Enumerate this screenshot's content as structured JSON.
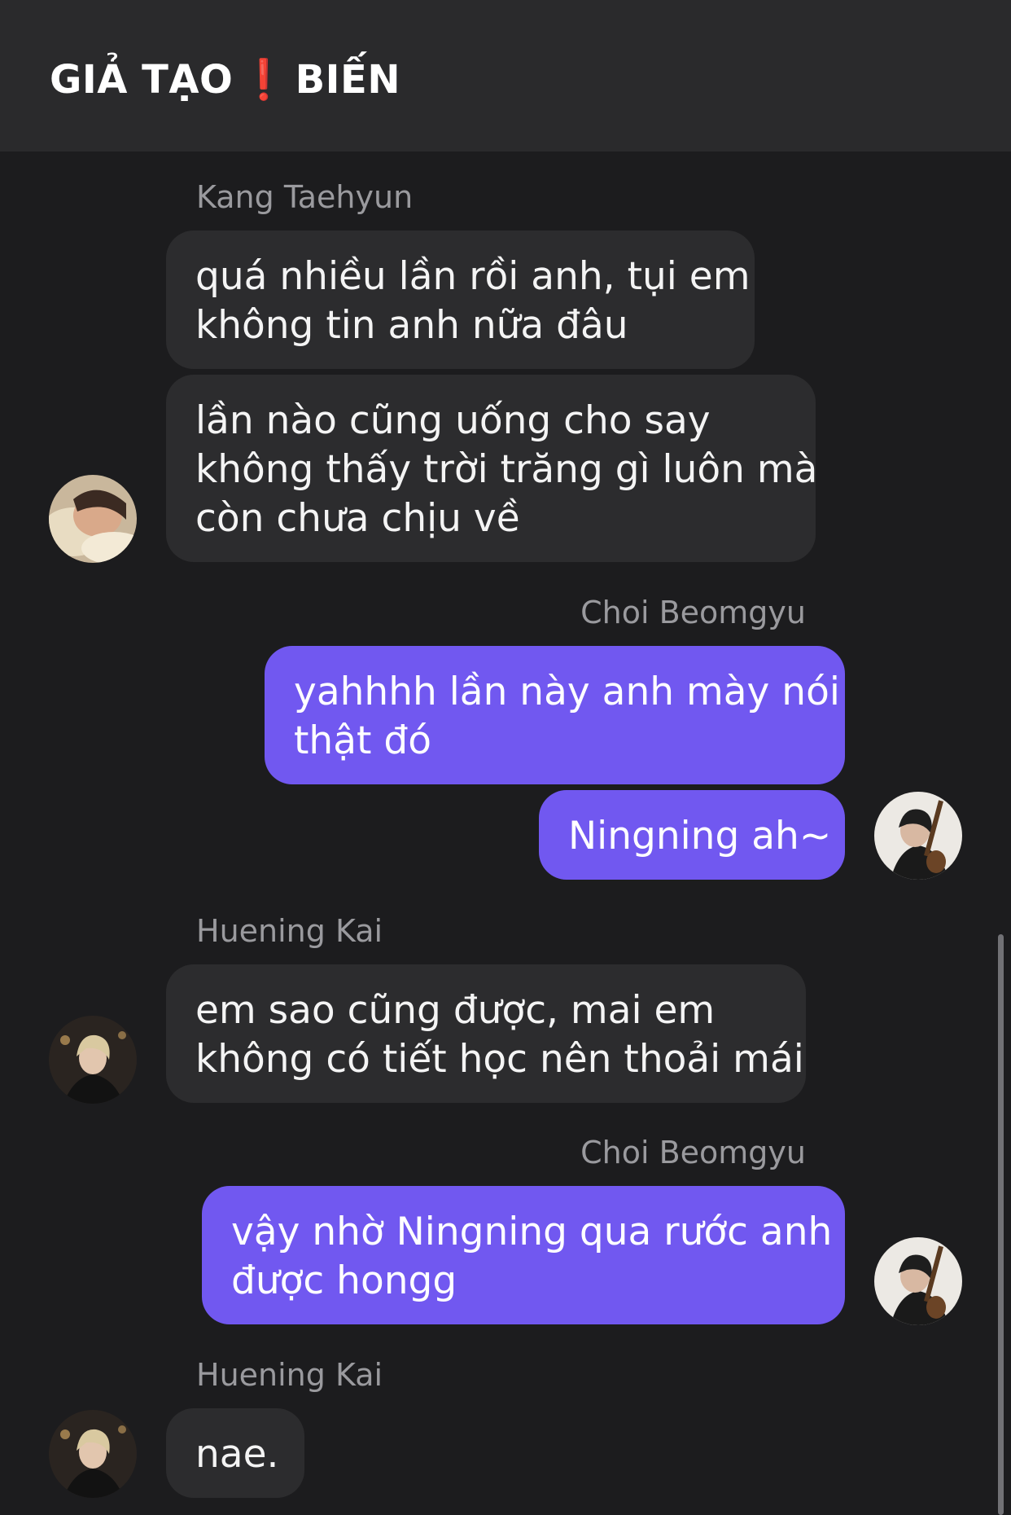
{
  "header": {
    "title_left": "GIẢ TẠO",
    "separator": "❗",
    "title_right": "BIẾN"
  },
  "messages": [
    {
      "sender": "Kang Taehyun",
      "bubbles": [
        [
          "quá nhiều lần rồi anh, tụi em",
          "không tin anh nữa đâu"
        ],
        [
          "lần nào cũng uống cho say",
          "không thấy trời trăng gì luôn mà",
          "còn chưa chịu về"
        ]
      ]
    },
    {
      "sender": "Choi Beomgyu",
      "bubbles": [
        [
          "yahhhh lần này anh mày nói",
          "thật đó"
        ],
        [
          "Ningning ah~"
        ]
      ]
    },
    {
      "sender": "Huening Kai",
      "bubbles": [
        [
          "em sao cũng được, mai em",
          "không có tiết học nên thoải mái"
        ]
      ]
    },
    {
      "sender": "Choi Beomgyu",
      "bubbles": [
        [
          "vậy nhờ Ningning qua rước anh",
          "được hongg"
        ]
      ]
    },
    {
      "sender": "Huening Kai",
      "bubbles": [
        [
          "nae."
        ]
      ]
    }
  ],
  "colors": {
    "background": "#1c1c1e",
    "header": "#2a2a2c",
    "incoming_bubble": "#2c2c2e",
    "outgoing_bubble": "#7158f0",
    "sender_text": "#9a9a9e",
    "separator": "#e53935"
  },
  "icons": {
    "avatar_taehyun": "avatar-photo",
    "avatar_beomgyu": "avatar-photo",
    "avatar_hueningkai": "avatar-photo"
  }
}
